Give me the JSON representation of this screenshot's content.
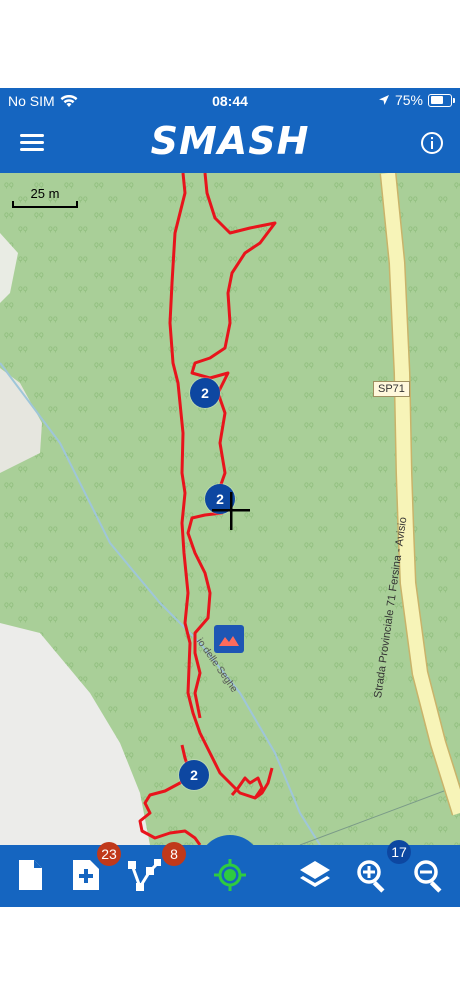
{
  "status": {
    "carrier": "No SIM",
    "time": "08:44",
    "battery": "75%",
    "battery_level": 0.75
  },
  "app": {
    "title": "SMASH"
  },
  "map": {
    "scale_label": "25 m",
    "road_shield": "SP71",
    "road_name": "Strada Provinciale 71 Fersina - Avisio",
    "path_name": "io delle Seghe",
    "clusters": [
      "2",
      "2",
      "2"
    ]
  },
  "toolbar": {
    "notes_badge": "23",
    "logs_badge": "8",
    "zoom_badge": "17"
  },
  "colors": {
    "bar_blue": "#1565c0",
    "map_green": "#a9cf98",
    "track_red": "#e8141c",
    "badge_red": "#c0391b",
    "gps_green": "#2ecc40"
  }
}
